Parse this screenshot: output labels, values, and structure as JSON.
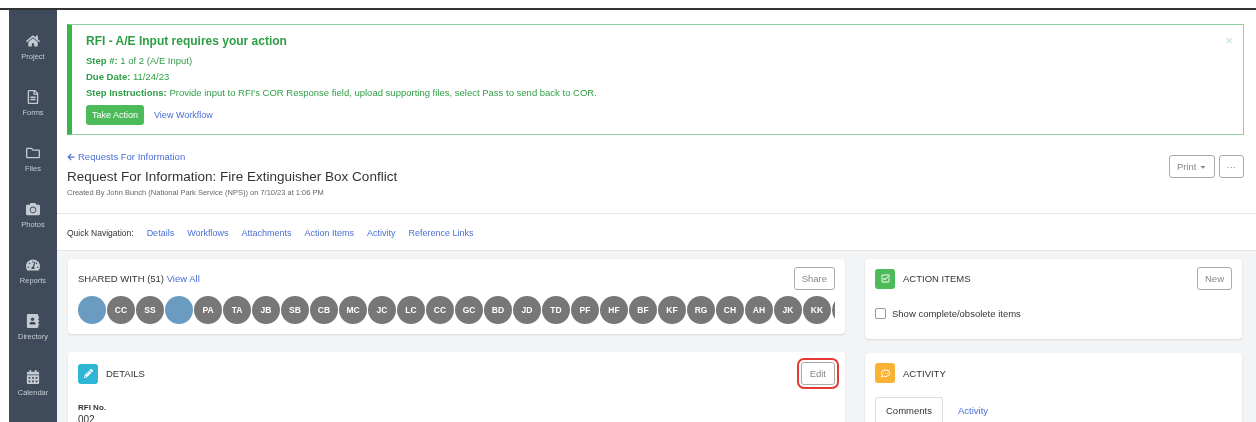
{
  "sidebar": {
    "items": [
      {
        "label": "Project"
      },
      {
        "label": "Forms"
      },
      {
        "label": "Files"
      },
      {
        "label": "Photos"
      },
      {
        "label": "Reports"
      },
      {
        "label": "Directory"
      },
      {
        "label": "Calendar"
      }
    ]
  },
  "banner": {
    "title": "RFI - A/E Input requires your action",
    "close": "×",
    "fields": [
      {
        "label": "Step #:",
        "value": "1 of 2 (A/E Input)"
      },
      {
        "label": "Due Date:",
        "value": "11/24/23"
      },
      {
        "label": "Step Instructions:",
        "value": "Provide input to RFI's COR Response field, upload supporting files, select Pass to send back to COR."
      }
    ],
    "primary_button": "Take Action",
    "link": "View Workflow"
  },
  "header": {
    "back_link": "Requests For Information",
    "title": "Request For Information: Fire Extinguisher Box Conflict",
    "subtitle": "Created By John Bunch (National Park Service (NPS)) on 7/10/23 at 1:06 PM",
    "print_button": "Print",
    "more_button": "···"
  },
  "quick_navigation": {
    "label": "Quick Navigation:",
    "links": [
      "Details",
      "Workflows",
      "Attachments",
      "Action Items",
      "Activity",
      "Reference Links"
    ]
  },
  "shared_with": {
    "title": "SHARED WITH (51)",
    "link": "View All",
    "button": "Share",
    "avatars": [
      {
        "kind": "photo"
      },
      {
        "kind": "initials",
        "initials": "CC"
      },
      {
        "kind": "initials",
        "initials": "SS"
      },
      {
        "kind": "photo"
      },
      {
        "kind": "initials",
        "initials": "PA"
      },
      {
        "kind": "initials",
        "initials": "TA"
      },
      {
        "kind": "initials",
        "initials": "JB"
      },
      {
        "kind": "initials",
        "initials": "SB"
      },
      {
        "kind": "initials",
        "initials": "CB"
      },
      {
        "kind": "initials",
        "initials": "MC"
      },
      {
        "kind": "initials",
        "initials": "JC"
      },
      {
        "kind": "initials",
        "initials": "LC"
      },
      {
        "kind": "initials",
        "initials": "CC"
      },
      {
        "kind": "initials",
        "initials": "GC"
      },
      {
        "kind": "initials",
        "initials": "BD"
      },
      {
        "kind": "initials",
        "initials": "JD"
      },
      {
        "kind": "initials",
        "initials": "TD"
      },
      {
        "kind": "initials",
        "initials": "PF"
      },
      {
        "kind": "initials",
        "initials": "HF"
      },
      {
        "kind": "initials",
        "initials": "BF"
      },
      {
        "kind": "initials",
        "initials": "KF"
      },
      {
        "kind": "initials",
        "initials": "RG"
      },
      {
        "kind": "initials",
        "initials": "CH"
      },
      {
        "kind": "initials",
        "initials": "AH"
      },
      {
        "kind": "initials",
        "initials": "JK"
      },
      {
        "kind": "initials",
        "initials": "KK"
      },
      {
        "kind": "blank"
      }
    ]
  },
  "details": {
    "title": "DETAILS",
    "edit_button": {
      "label": "Edit",
      "highlighted": true
    },
    "field_label": "RFI No.",
    "field_value": "002"
  },
  "action_items": {
    "title": "ACTION ITEMS",
    "button": "New",
    "checkbox": {
      "label": "Show complete/obsolete items",
      "checked": false
    }
  },
  "activity": {
    "title": "ACTIVITY",
    "tabs": [
      {
        "label": "Comments",
        "selected": true
      },
      {
        "label": "Activity",
        "selected": false
      }
    ]
  }
}
